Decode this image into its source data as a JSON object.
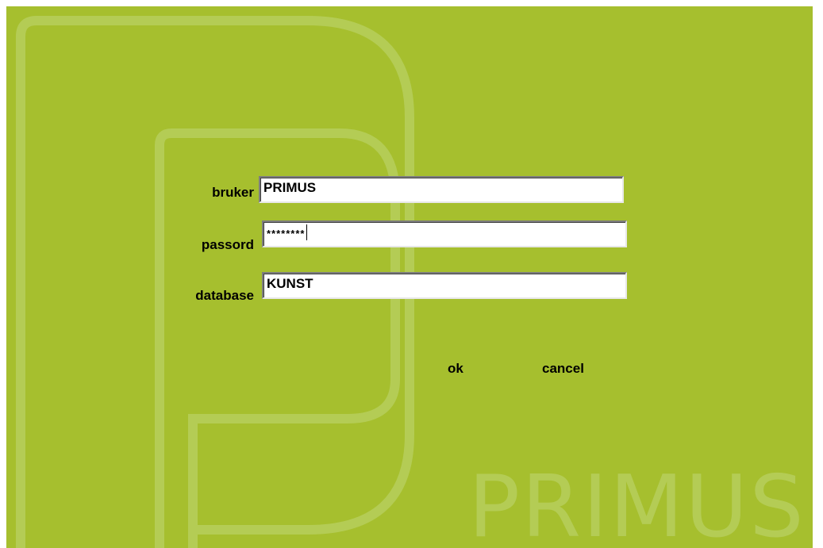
{
  "app": {
    "watermark": "PRIMUS",
    "background_color": "#a6bf2e",
    "logo_color": "#b4cc55"
  },
  "login": {
    "user_label": "bruker",
    "user_value": "PRIMUS",
    "password_label": "passord",
    "password_value": "********",
    "database_label": "database",
    "database_value": "KUNST"
  },
  "actions": {
    "ok_label": "ok",
    "cancel_label": "cancel"
  }
}
